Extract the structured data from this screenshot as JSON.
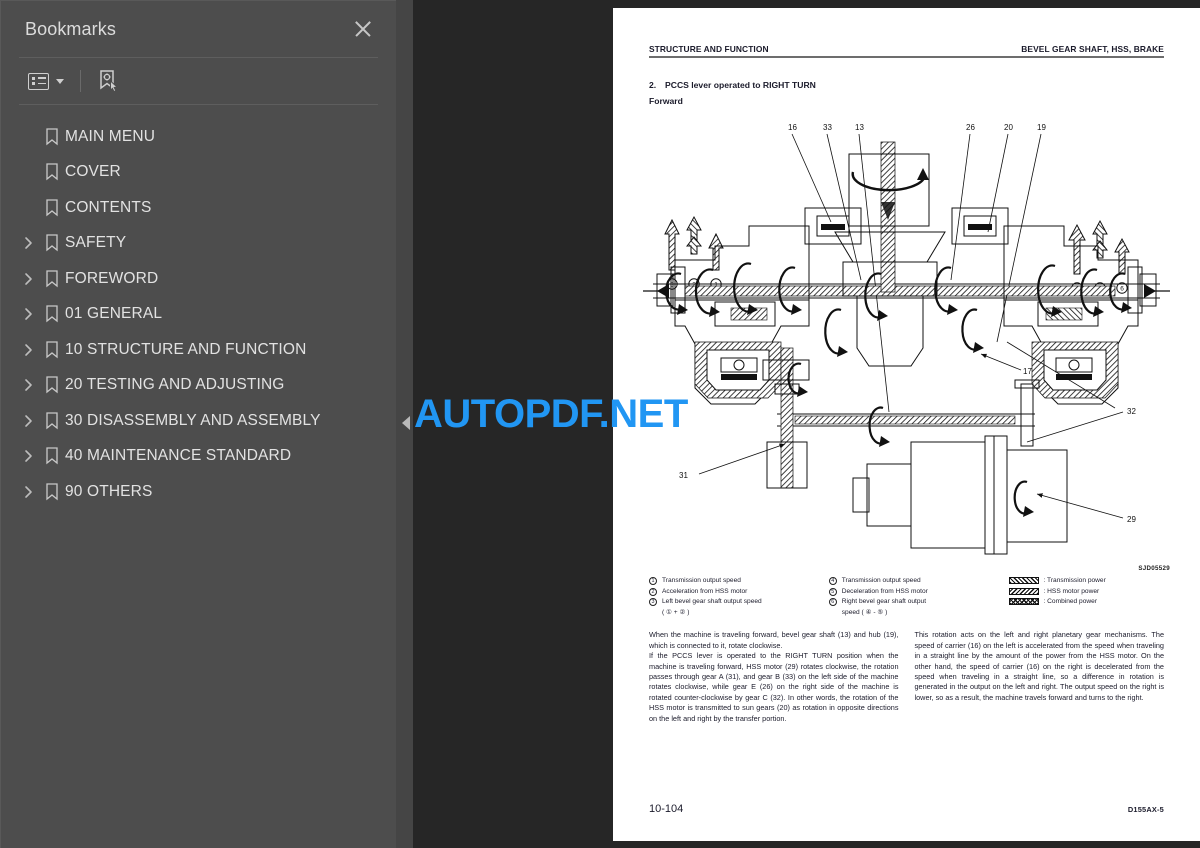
{
  "sidebar": {
    "title": "Bookmarks",
    "close_icon": "close-icon",
    "toolbar": {
      "options_icon": "list-options-icon",
      "caret_icon": "chevron-down-icon",
      "new_bookmark_icon": "bookmark-add-icon"
    },
    "items": [
      {
        "label": "MAIN MENU",
        "expandable": false
      },
      {
        "label": "COVER",
        "expandable": false
      },
      {
        "label": "CONTENTS",
        "expandable": false
      },
      {
        "label": "SAFETY",
        "expandable": true
      },
      {
        "label": "FOREWORD",
        "expandable": true
      },
      {
        "label": "01 GENERAL",
        "expandable": true
      },
      {
        "label": "10 STRUCTURE AND FUNCTION",
        "expandable": true
      },
      {
        "label": "20 TESTING AND ADJUSTING",
        "expandable": true
      },
      {
        "label": "30 DISASSEMBLY AND ASSEMBLY",
        "expandable": true
      },
      {
        "label": "40 MAINTENANCE STANDARD",
        "expandable": true
      },
      {
        "label": "90 OTHERS",
        "expandable": true
      }
    ]
  },
  "viewer": {
    "collapse_handle_icon": "collapse-left-icon",
    "watermark": "AUTOPDF.NET",
    "watermark_color": "#2196f3"
  },
  "page": {
    "header_left": "STRUCTURE AND FUNCTION",
    "header_right": "BEVEL GEAR SHAFT, HSS, BRAKE",
    "section_number": "2.",
    "section_title": "PCCS lever operated to RIGHT TURN",
    "subtitle": "Forward",
    "figure_id": "SJD05529",
    "figure_callouts": [
      "16",
      "33",
      "13",
      "26",
      "20",
      "19",
      "32",
      "31",
      "29",
      "17"
    ],
    "figure_arrow_groups": [
      [
        "3",
        "2",
        "1"
      ],
      [
        "4",
        "5",
        "6"
      ]
    ],
    "legend": {
      "col1": [
        {
          "mark": "1",
          "text": "Transmission output speed"
        },
        {
          "mark": "2",
          "text": "Acceleration from HSS motor"
        },
        {
          "mark": "3",
          "text": "Left bevel gear shaft output speed"
        },
        {
          "mark": "",
          "text": "( ① + ② )"
        }
      ],
      "col2": [
        {
          "mark": "4",
          "text": "Transmission output speed"
        },
        {
          "mark": "5",
          "text": "Deceleration from HSS motor"
        },
        {
          "mark": "6",
          "text": "Right bevel gear shaft output"
        },
        {
          "mark": "",
          "text": "speed ( ④ - ⑤ )"
        }
      ],
      "col3": [
        {
          "swatch": "trans",
          "text": ": Transmission power"
        },
        {
          "swatch": "hss",
          "text": ": HSS motor power"
        },
        {
          "swatch": "comb",
          "text": ": Combined power"
        }
      ]
    },
    "body_left": [
      "When the machine is traveling forward, bevel gear shaft (13) and hub (19), which is connected to it, rotate clockwise.",
      "If the PCCS lever is operated to the RIGHT TURN position when the machine is traveling forward, HSS motor (29) rotates clockwise, the rotation passes through gear A (31), and gear B (33) on the left side of the machine rotates clockwise, while gear E (26) on the right side of the machine is rotated counter-clockwise by gear C (32).  In other words, the rotation of the HSS motor is transmitted to sun gears (20) as rotation in opposite directions on the left and right by the transfer portion."
    ],
    "body_right": [
      "This rotation acts on the left and right planetary gear mechanisms.  The speed of carrier (16) on the left is accelerated from the speed when traveling in a straight line by the amount of the power from the HSS motor.  On the other hand, the speed of carrier (16) on the right is decelerated from the speed when traveling in a straight line, so a difference in rotation is generated in the output on the left and right.  The output speed on the right is lower, so as a result, the machine travels forward and turns to the right."
    ],
    "footer_page": "10-104",
    "footer_model": "D155AX-5"
  }
}
